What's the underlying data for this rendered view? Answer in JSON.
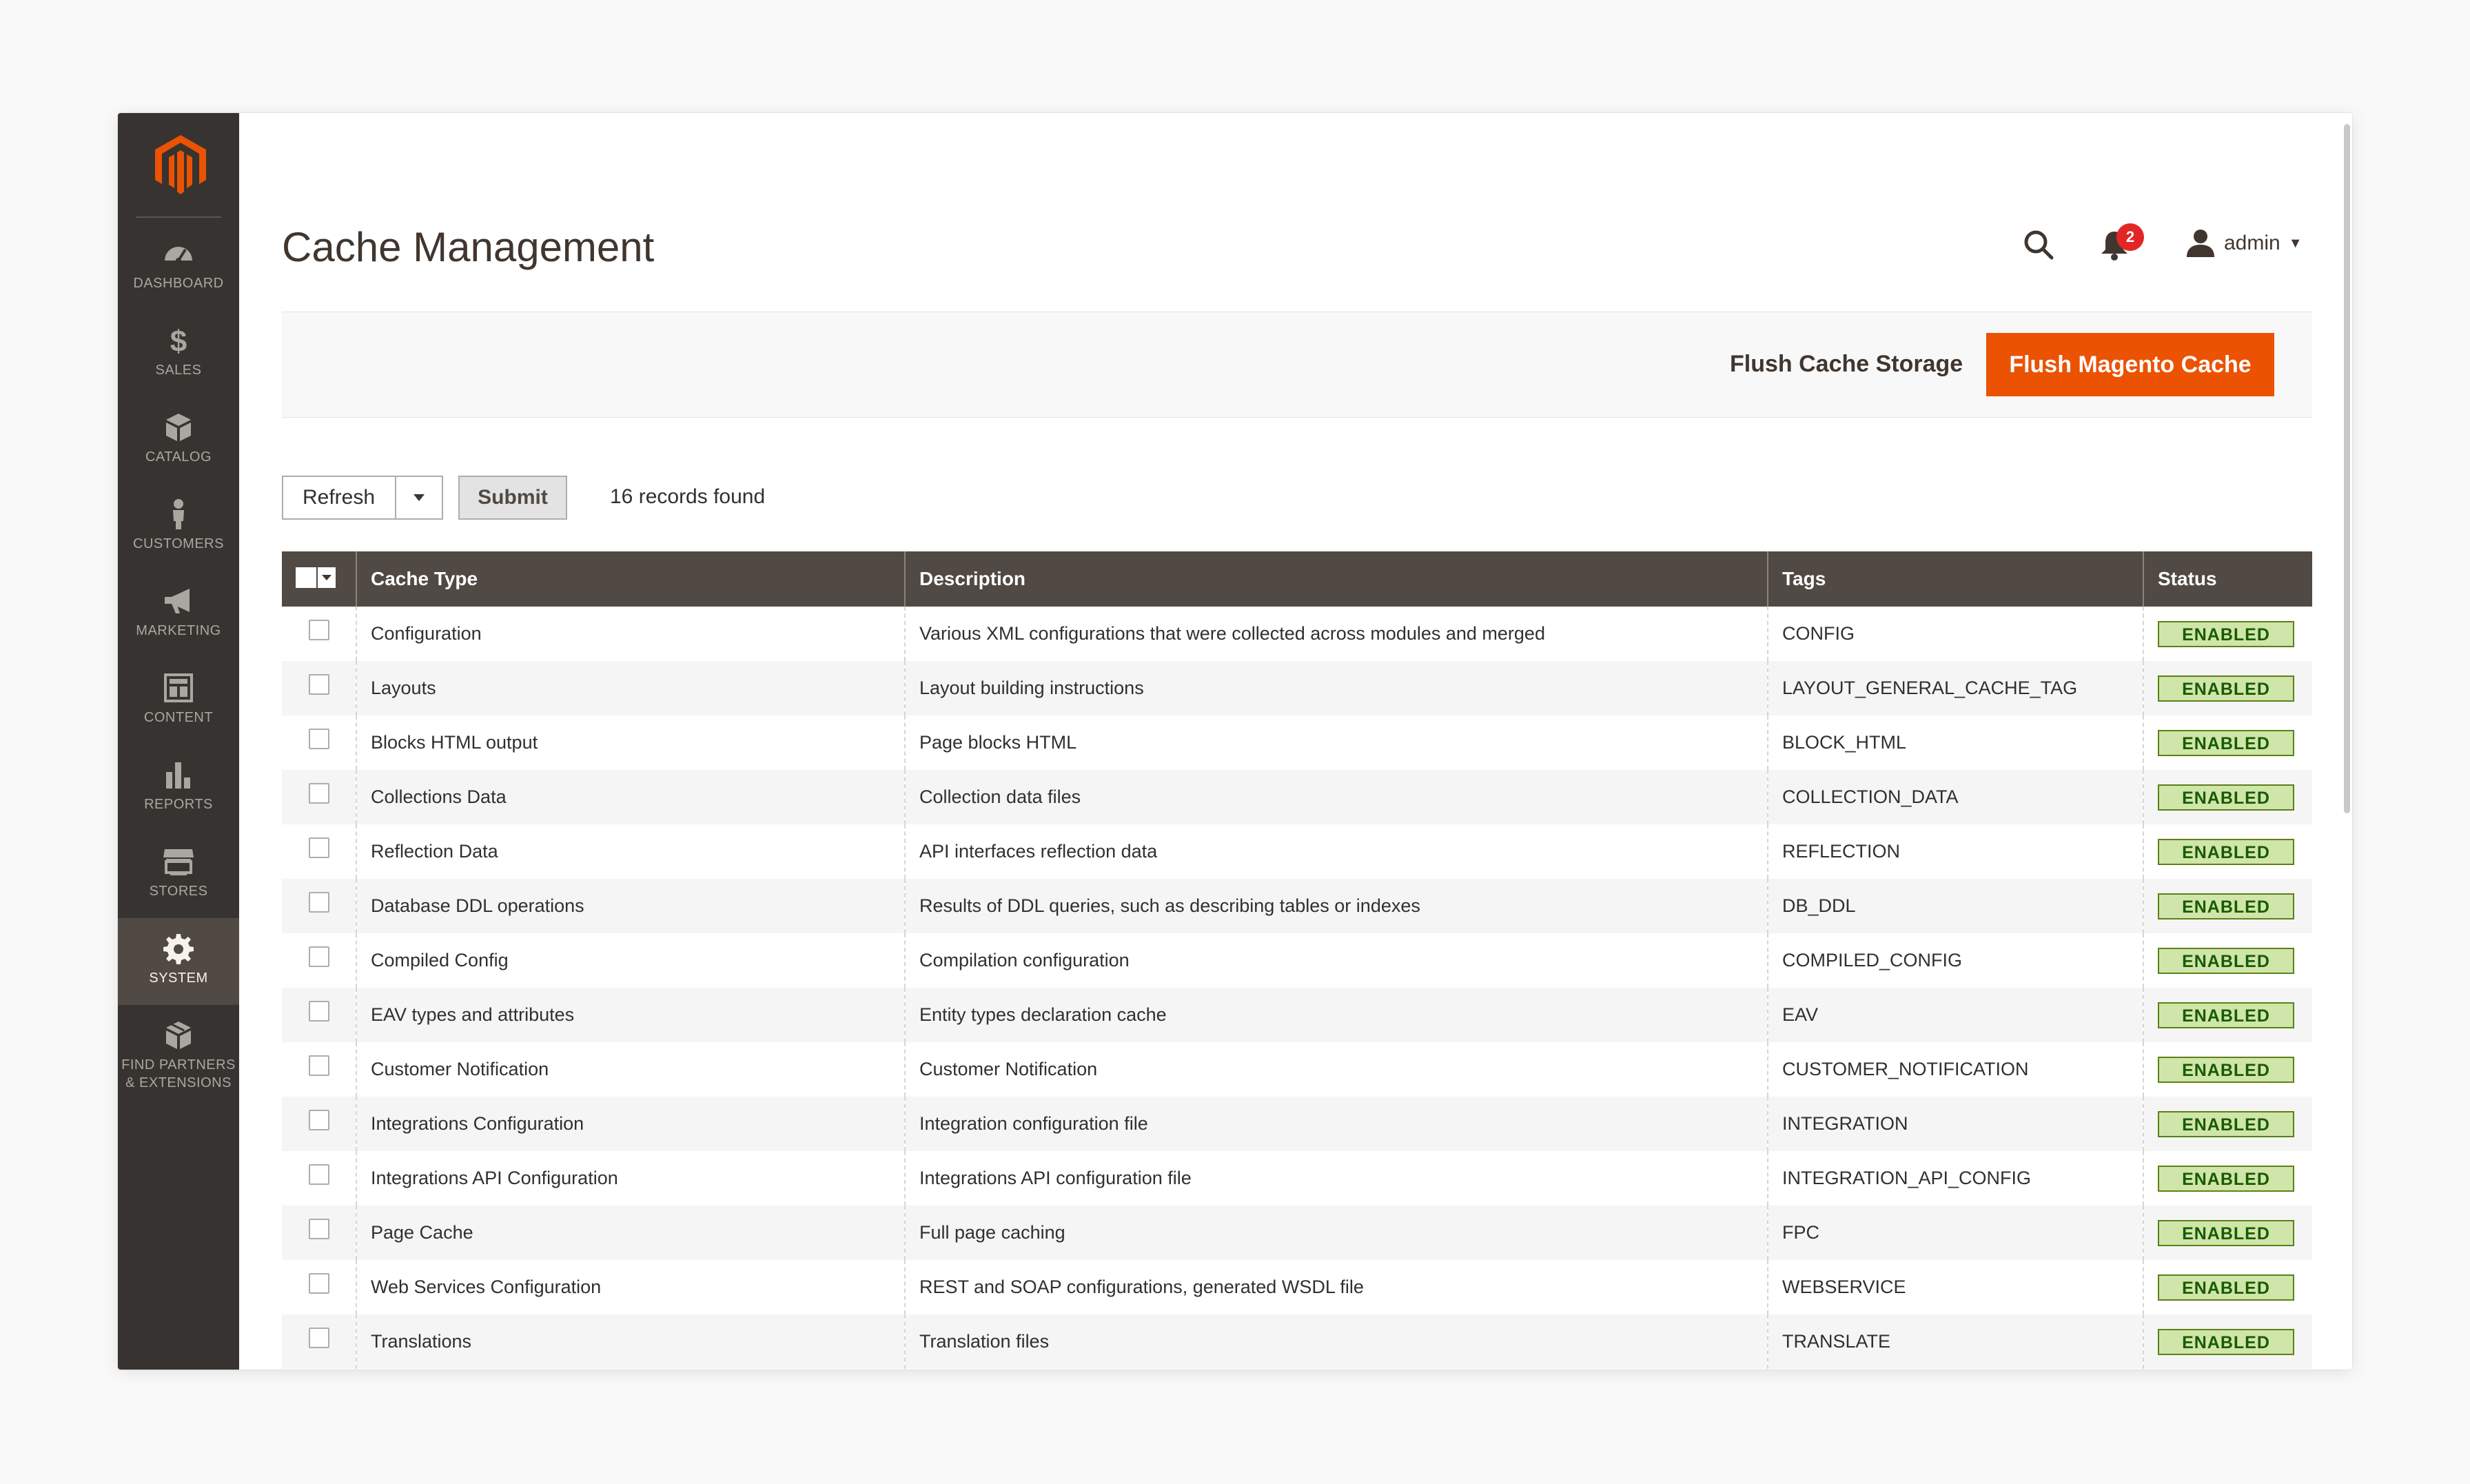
{
  "sidebar": {
    "items": [
      {
        "key": "dashboard",
        "label": "DASHBOARD"
      },
      {
        "key": "sales",
        "label": "SALES"
      },
      {
        "key": "catalog",
        "label": "CATALOG"
      },
      {
        "key": "customers",
        "label": "CUSTOMERS"
      },
      {
        "key": "marketing",
        "label": "MARKETING"
      },
      {
        "key": "content",
        "label": "CONTENT"
      },
      {
        "key": "reports",
        "label": "REPORTS"
      },
      {
        "key": "stores",
        "label": "STORES"
      },
      {
        "key": "system",
        "label": "SYSTEM",
        "active": true
      },
      {
        "key": "partners",
        "label_line1": "FIND PARTNERS",
        "label_line2": "& EXTENSIONS"
      }
    ]
  },
  "header": {
    "title": "Cache Management",
    "notifications_count": "2",
    "user_name": "admin"
  },
  "actions": {
    "flush_storage": "Flush Cache Storage",
    "flush_magento": "Flush Magento Cache"
  },
  "mass_action": {
    "selected": "Refresh",
    "submit": "Submit",
    "records_found": "16 records found"
  },
  "grid": {
    "columns": [
      "Cache Type",
      "Description",
      "Tags",
      "Status"
    ],
    "rows": [
      {
        "type": "Configuration",
        "description": "Various XML configurations that were collected across modules and merged",
        "tags": "CONFIG",
        "status": "ENABLED"
      },
      {
        "type": "Layouts",
        "description": "Layout building instructions",
        "tags": "LAYOUT_GENERAL_CACHE_TAG",
        "status": "ENABLED"
      },
      {
        "type": "Blocks HTML output",
        "description": "Page blocks HTML",
        "tags": "BLOCK_HTML",
        "status": "ENABLED"
      },
      {
        "type": "Collections Data",
        "description": "Collection data files",
        "tags": "COLLECTION_DATA",
        "status": "ENABLED"
      },
      {
        "type": "Reflection Data",
        "description": "API interfaces reflection data",
        "tags": "REFLECTION",
        "status": "ENABLED"
      },
      {
        "type": "Database DDL operations",
        "description": "Results of DDL queries, such as describing tables or indexes",
        "tags": "DB_DDL",
        "status": "ENABLED"
      },
      {
        "type": "Compiled Config",
        "description": "Compilation configuration",
        "tags": "COMPILED_CONFIG",
        "status": "ENABLED"
      },
      {
        "type": "EAV types and attributes",
        "description": "Entity types declaration cache",
        "tags": "EAV",
        "status": "ENABLED"
      },
      {
        "type": "Customer Notification",
        "description": "Customer Notification",
        "tags": "CUSTOMER_NOTIFICATION",
        "status": "ENABLED"
      },
      {
        "type": "Integrations Configuration",
        "description": "Integration configuration file",
        "tags": "INTEGRATION",
        "status": "ENABLED"
      },
      {
        "type": "Integrations API Configuration",
        "description": "Integrations API configuration file",
        "tags": "INTEGRATION_API_CONFIG",
        "status": "ENABLED"
      },
      {
        "type": "Page Cache",
        "description": "Full page caching",
        "tags": "FPC",
        "status": "ENABLED"
      },
      {
        "type": "Web Services Configuration",
        "description": "REST and SOAP configurations, generated WSDL file",
        "tags": "WEBSERVICE",
        "status": "ENABLED"
      },
      {
        "type": "Translations",
        "description": "Translation files",
        "tags": "TRANSLATE",
        "status": "ENABLED"
      }
    ]
  },
  "colors": {
    "sidebar_bg": "#373330",
    "sidebar_active": "#514943",
    "accent": "#eb5202",
    "grid_header": "#514943",
    "status_bg": "#d0e5a9",
    "status_text": "#185b00"
  }
}
